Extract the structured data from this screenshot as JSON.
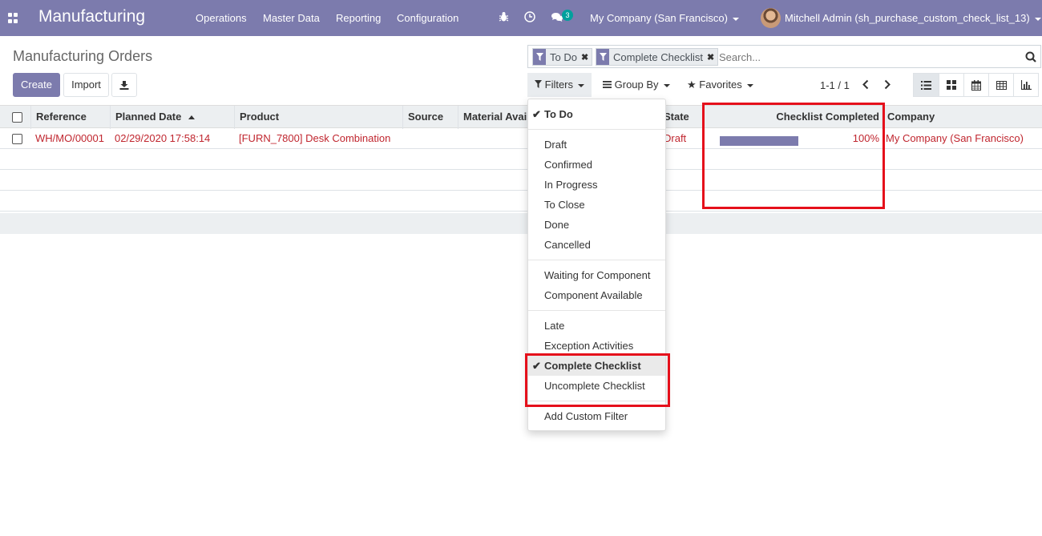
{
  "navbar": {
    "app_title": "Manufacturing",
    "menu": [
      "Operations",
      "Master Data",
      "Reporting",
      "Configuration"
    ],
    "messages_count": "3",
    "company": "My Company (San Francisco)",
    "user": "Mitchell Admin (sh_purchase_custom_check_list_13)"
  },
  "control": {
    "breadcrumb": "Manufacturing Orders",
    "create_label": "Create",
    "import_label": "Import",
    "facets": [
      "To Do",
      "Complete Checklist"
    ],
    "search_placeholder": "Search...",
    "filters_label": "Filters",
    "groupby_label": "Group By",
    "favorites_label": "Favorites",
    "pager": "1-1 / 1"
  },
  "table": {
    "columns": [
      "Reference",
      "Planned Date",
      "Product",
      "Source",
      "Material Availability",
      "State",
      "Checklist Completed",
      "Company"
    ],
    "rows": [
      {
        "reference": "WH/MO/00001",
        "planned_date": "02/29/2020 17:58:14",
        "product": "[FURN_7800] Desk Combination",
        "source": "",
        "state": "Draft",
        "checklist_progress": 1.0,
        "checklist_text": "100%",
        "company": "My Company (San Francisco)"
      }
    ]
  },
  "filters_menu": {
    "group1": [
      {
        "label": "To Do",
        "checked": true
      }
    ],
    "group2": [
      "Draft",
      "Confirmed",
      "In Progress",
      "To Close",
      "Done",
      "Cancelled"
    ],
    "group3": [
      "Waiting for Component",
      "Component Available"
    ],
    "group4": [
      {
        "label": "Late",
        "checked": false
      },
      {
        "label": "Exception Activities",
        "checked": false
      },
      {
        "label": "Complete Checklist",
        "checked": true
      },
      {
        "label": "Uncomplete Checklist",
        "checked": false
      }
    ],
    "custom": "Add Custom Filter"
  },
  "colors": {
    "brand": "#7c7bad",
    "link_red": "#c0262f",
    "highlight_red": "#e5101b"
  }
}
